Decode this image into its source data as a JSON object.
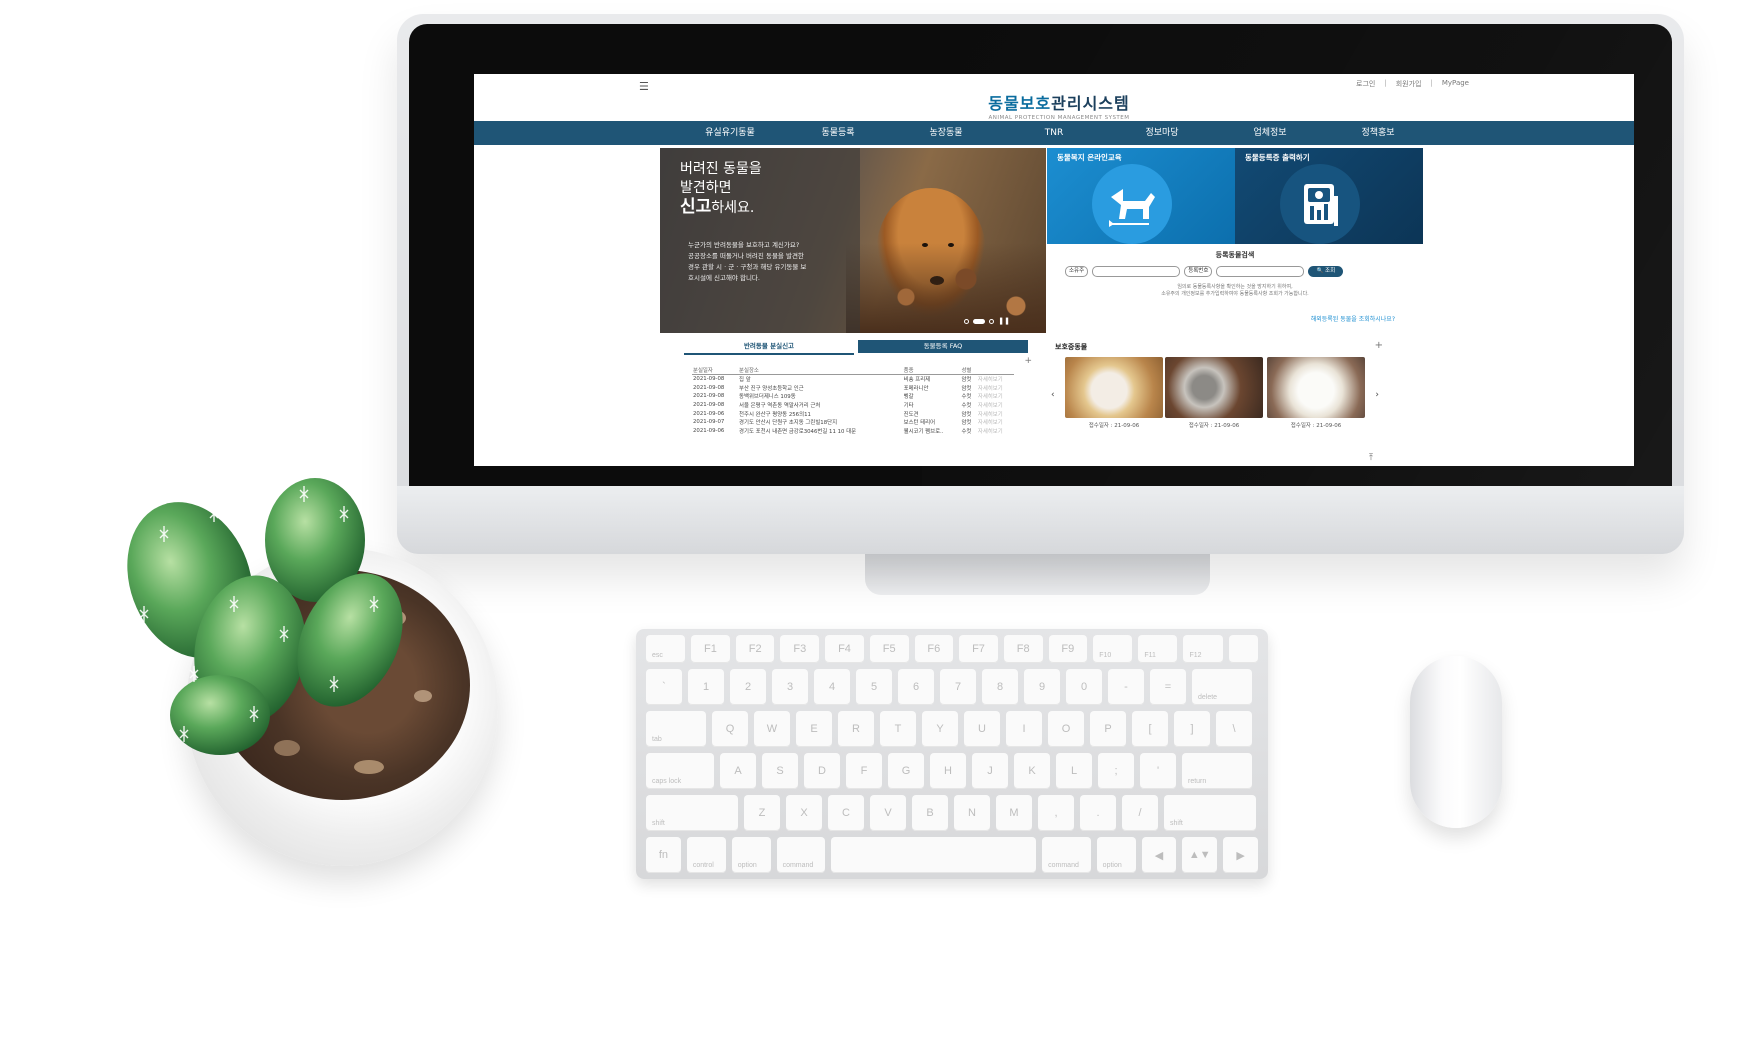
{
  "header": {
    "menu_icon": "☰",
    "links": [
      "로그인",
      "회원가입",
      "MyPage"
    ],
    "link_separator": "|",
    "logo_accent": "동물보호",
    "logo_rest": "관리시스템",
    "logo_en": "ANIMAL PROTECTION MANAGEMENT SYSTEM"
  },
  "nav": [
    "유실유기동물",
    "동물등록",
    "농장동물",
    "TNR",
    "정보마당",
    "업체정보",
    "정책홍보"
  ],
  "hero": {
    "line1": "버려진 동물을",
    "line2": "발견하면",
    "line3_em": "신고",
    "line3_rest": "하세요.",
    "desc1": "누군가의 반려동물을 보호하고 계신가요?",
    "desc2": "공공장소를 떠돌거나 버려진 동물을 발견한",
    "desc3": "경우 관할 시 · 군 · 구청과 해당 유기동물 보",
    "desc4": "호시설에 신고해야 합니다.",
    "pause_icon": "❚❚"
  },
  "tiles": {
    "tile1_label": "동물복지 온라인교육",
    "tile2_label": "동물등록증 출력하기"
  },
  "search": {
    "title": "등록동물검색",
    "owner_select": "소유주",
    "reg_select": "등록번호",
    "button": "조회",
    "search_icon": "🔍",
    "note1": "임의로 동물등록사항을 확인하는 것을 방지하기 위하여,",
    "note2": "소유주의 개인정보를 추가입력하여야 동물등록사항 조회가 가능합니다.",
    "link": "해외등록된 동물을 조회하시나요?"
  },
  "lost": {
    "tab_active": "반려동물 분실신고",
    "tab_other": "동물등록 FAQ",
    "plus": "+",
    "headers": [
      "분실일자",
      "분실장소",
      "품종",
      "성별",
      ""
    ],
    "rows": [
      [
        "2021-09-08",
        "집 앞",
        "비숑 프리제",
        "암컷",
        "자세히보기"
      ],
      [
        "2021-09-08",
        "부산 진구 양성초등학교 인근",
        "포메라니안",
        "암컷",
        "자세히보기"
      ],
      [
        "2021-09-08",
        "동백위브더제니스 109동",
        "벵갈",
        "수컷",
        "자세히보기"
      ],
      [
        "2021-09-08",
        "서울 은평구 역촌동 역말사거리 근처",
        "기타",
        "수컷",
        "자세히보기"
      ],
      [
        "2021-09-06",
        "천주시 완산구 평양동 256의11",
        "진도견",
        "암컷",
        "자세히보기"
      ],
      [
        "2021-09-07",
        "경기도 안산시 단원구 초지동 그린빌18단지",
        "보스턴 테리어",
        "암컷",
        "자세히보기"
      ],
      [
        "2021-09-06",
        "경기도 포천시 내촌면 금강로3046번길 11 10 대문",
        "웰시코기 펨브로..",
        "수컷",
        "자세히보기"
      ]
    ]
  },
  "protect": {
    "title": "보호중동물",
    "plus": "+",
    "prev": "‹",
    "next": "›",
    "captions": [
      "접수일자 : 21-09-06",
      "접수일자 : 21-09-06",
      "접수일자 : 21-09-06"
    ],
    "top_icon": "⤒"
  },
  "keyboard": {
    "row0": [
      "esc",
      "F1",
      "F2",
      "F3",
      "F4",
      "F5",
      "F6",
      "F7",
      "F8",
      "F9",
      "F10",
      "F11",
      "F12",
      ""
    ],
    "row1": [
      "`",
      "1",
      "2",
      "3",
      "4",
      "5",
      "6",
      "7",
      "8",
      "9",
      "0",
      "-",
      "=",
      "delete"
    ],
    "row2": [
      "tab",
      "Q",
      "W",
      "E",
      "R",
      "T",
      "Y",
      "U",
      "I",
      "O",
      "P",
      "[",
      "]",
      "\\"
    ],
    "row3": [
      "caps lock",
      "A",
      "S",
      "D",
      "F",
      "G",
      "H",
      "J",
      "K",
      "L",
      ";",
      "'",
      "return"
    ],
    "row4": [
      "shift",
      "Z",
      "X",
      "C",
      "V",
      "B",
      "N",
      "M",
      ",",
      ".",
      "/",
      "shift"
    ],
    "row5": [
      "fn",
      "control",
      "option",
      "command",
      "",
      "command",
      "option",
      "◀",
      "▲▼",
      "▶"
    ]
  }
}
